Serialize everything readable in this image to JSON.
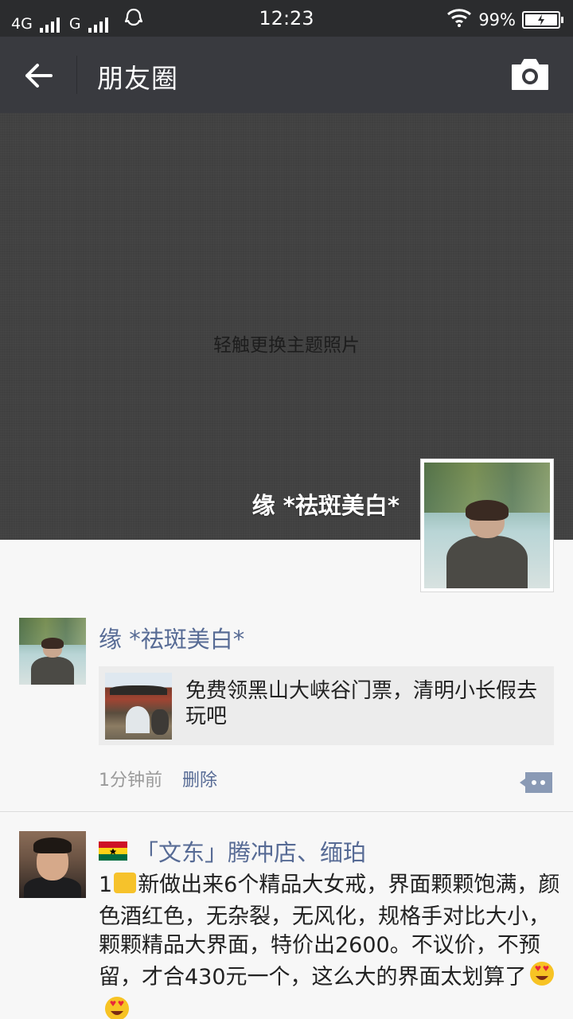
{
  "status_bar": {
    "network1": "4G",
    "network2": "G",
    "time": "12:23",
    "battery": "99%"
  },
  "nav": {
    "title": "朋友圈"
  },
  "cover": {
    "hint": "轻触更换主题照片",
    "username": "缘  *祛斑美白*"
  },
  "posts": [
    {
      "name": "缘  *祛斑美白*",
      "link_text": "免费领黑山大峡谷门票，清明小长假去玩吧",
      "time": "1分钟前",
      "delete_label": "删除"
    },
    {
      "name": "「文东」腾冲店、缅珀",
      "body_start": "1",
      "body_text": "新做出来6个精品大女戒，界面颗颗饱满，颜色酒红色，无杂裂，无风化，规格手对比大小，颗颗精品大界面，特价出2600。不议价，不预留，才合430元一个，这么大的界面太划算了"
    }
  ],
  "icons": {
    "back": "back-arrow-icon",
    "camera": "camera-icon",
    "comment": "comment-icon",
    "wifi": "wifi-icon",
    "qq": "qq-icon",
    "flag": "ghana-flag-icon",
    "emoji": "heart-eyes-emoji-icon"
  }
}
